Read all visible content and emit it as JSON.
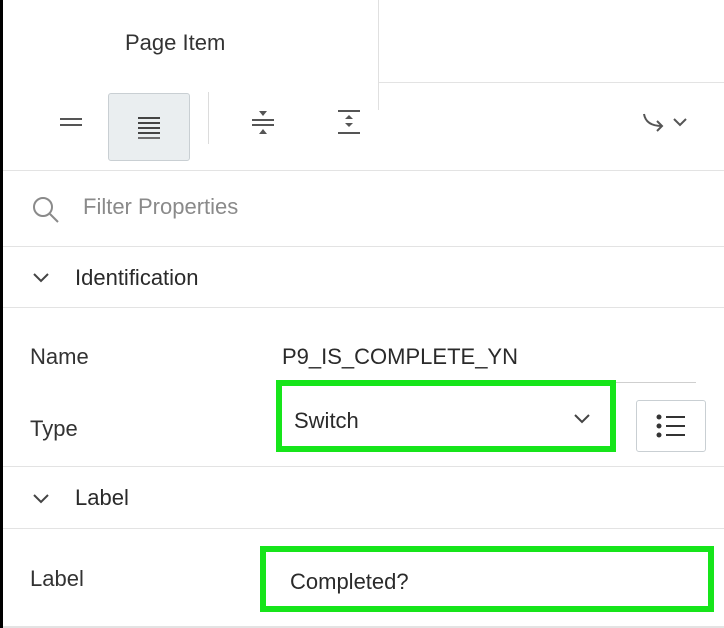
{
  "tabs": [
    {
      "label": "Page Item",
      "active": true
    }
  ],
  "toolbar": {
    "buttons": [
      {
        "icon": "show-common-icon"
      },
      {
        "icon": "show-all-icon",
        "active": true
      },
      {
        "icon": "collapse-all-icon"
      },
      {
        "icon": "expand-all-icon"
      },
      {
        "icon": "go-to-group-icon"
      }
    ]
  },
  "filter": {
    "placeholder": "Filter Properties",
    "icon": "search-icon"
  },
  "sections": {
    "identification": {
      "title": "Identification",
      "name_label": "Name",
      "name_value": "P9_IS_COMPLETE_YN",
      "type_label": "Type",
      "type_value": "Switch"
    },
    "label": {
      "title": "Label",
      "label_label": "Label",
      "label_value": "Completed?"
    }
  },
  "colors": {
    "highlight": "#16e51a",
    "border": "#e3e3e3",
    "active_button_bg": "#eaeef0"
  }
}
